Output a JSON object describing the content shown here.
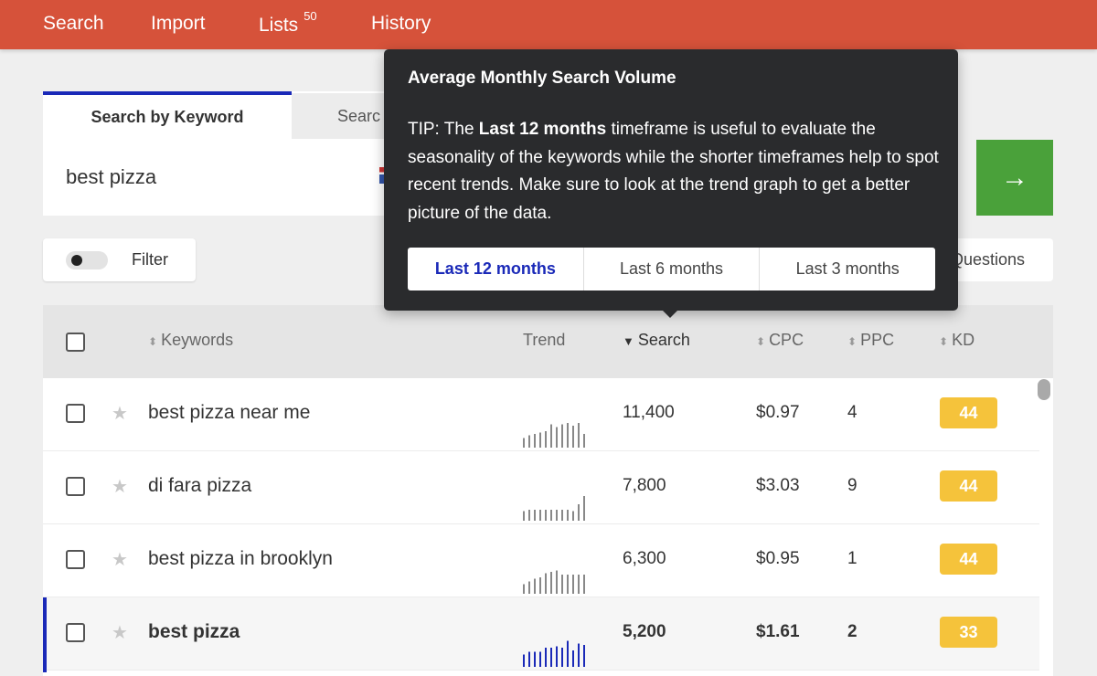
{
  "nav": {
    "search": "Search",
    "import": "Import",
    "lists": "Lists",
    "lists_count": "50",
    "history": "History"
  },
  "search_panel": {
    "tab_keyword": "Search by Keyword",
    "tab_other_partial": "Searc",
    "input_value": "best pizza"
  },
  "go_button": {
    "icon": "arrow-right-icon",
    "glyph": "→"
  },
  "filter": {
    "label": "Filter",
    "toggle_on": false
  },
  "questions_tab": {
    "label_partial": "Questions"
  },
  "table": {
    "headers": {
      "keywords": "Keywords",
      "trend": "Trend",
      "search": "Search",
      "cpc": "CPC",
      "ppc": "PPC",
      "kd": "KD"
    },
    "sort_icons": {
      "neutral": "⬍",
      "desc": "▼"
    },
    "rows": [
      {
        "keyword": "best pizza near me",
        "search": "11,400",
        "cpc": "$0.97",
        "ppc": "4",
        "kd": "44",
        "selected": false,
        "trend": [
          0.35,
          0.45,
          0.5,
          0.55,
          0.6,
          0.85,
          0.75,
          0.85,
          0.9,
          0.8,
          0.9,
          0.5
        ]
      },
      {
        "keyword": "di fara pizza",
        "search": "7,800",
        "cpc": "$3.03",
        "ppc": "9",
        "kd": "44",
        "selected": false,
        "trend": [
          0.35,
          0.4,
          0.4,
          0.4,
          0.4,
          0.4,
          0.4,
          0.4,
          0.4,
          0.35,
          0.6,
          0.9
        ]
      },
      {
        "keyword": "best pizza in brooklyn",
        "search": "6,300",
        "cpc": "$0.95",
        "ppc": "1",
        "kd": "44",
        "selected": false,
        "trend": [
          0.35,
          0.45,
          0.55,
          0.6,
          0.75,
          0.8,
          0.85,
          0.7,
          0.7,
          0.7,
          0.7,
          0.7
        ]
      },
      {
        "keyword": "best pizza",
        "search": "5,200",
        "cpc": "$1.61",
        "ppc": "2",
        "kd": "33",
        "selected": true,
        "trend": [
          0.45,
          0.55,
          0.55,
          0.55,
          0.7,
          0.7,
          0.75,
          0.7,
          0.95,
          0.6,
          0.85,
          0.8
        ]
      }
    ]
  },
  "tooltip": {
    "title": "Average Monthly Search Volume",
    "tip_prefix": "TIP: The ",
    "tip_bold": "Last 12 months",
    "tip_rest": " timeframe is useful to evaluate the seasonality of the keywords while the shorter timeframes help to spot recent trends. Make sure to look at the trend graph to get a better picture of the data.",
    "options": [
      "Last 12 months",
      "Last 6 months",
      "Last 3 months"
    ],
    "active_option": 0
  },
  "colors": {
    "nav_bg": "#d6523a",
    "accent_blue": "#1a29b8",
    "go_green": "#4aa13a",
    "kd_yellow": "#f5c33b",
    "tooltip_bg": "#2a2b2d",
    "trend_gray": "#888888"
  }
}
